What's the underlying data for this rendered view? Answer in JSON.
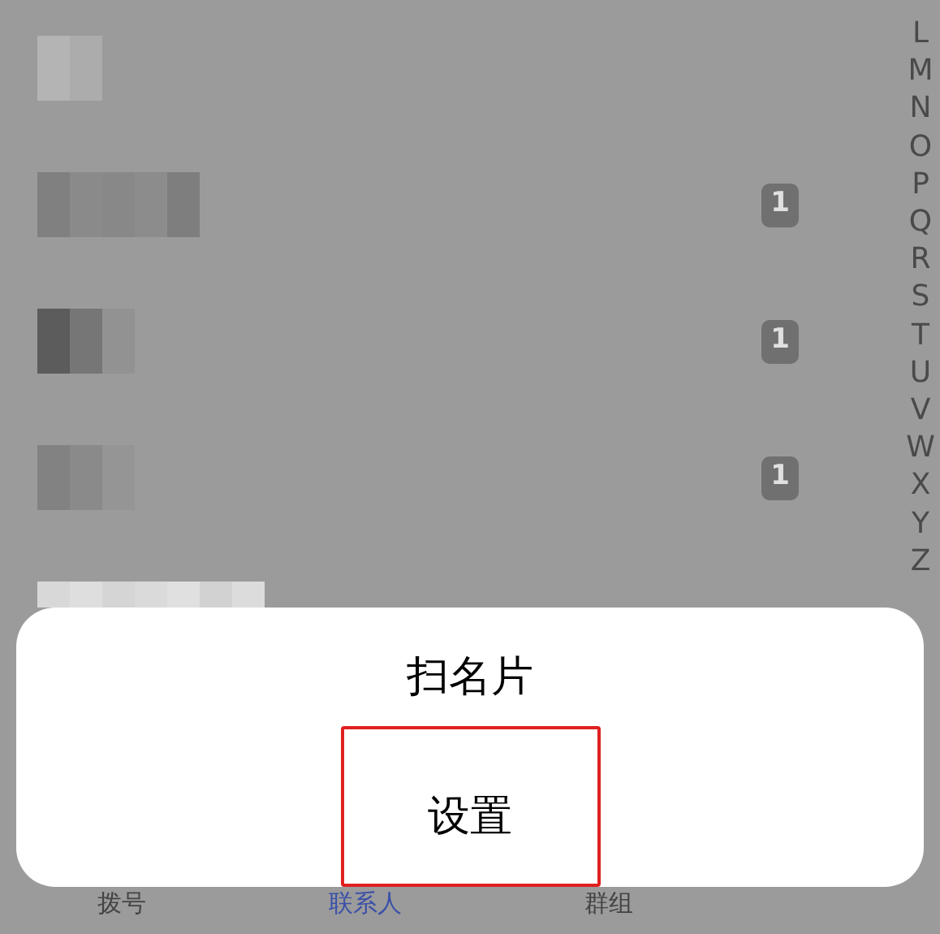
{
  "contacts": [
    {
      "sim_badge": false
    },
    {
      "sim_badge": true,
      "sim": "1"
    },
    {
      "sim_badge": true,
      "sim": "1"
    },
    {
      "sim_badge": true,
      "sim": "1"
    },
    {
      "sim_badge": false
    }
  ],
  "index_letters": [
    "L",
    "M",
    "N",
    "O",
    "P",
    "Q",
    "R",
    "S",
    "T",
    "U",
    "V",
    "W",
    "X",
    "Y",
    "Z"
  ],
  "action_sheet": [
    {
      "label": "扫名片",
      "highlighted": false
    },
    {
      "label": "设置",
      "highlighted": true
    }
  ],
  "tabs": [
    {
      "label": "拨号",
      "selected": false
    },
    {
      "label": "联系人",
      "selected": true
    },
    {
      "label": "群组",
      "selected": false
    }
  ]
}
